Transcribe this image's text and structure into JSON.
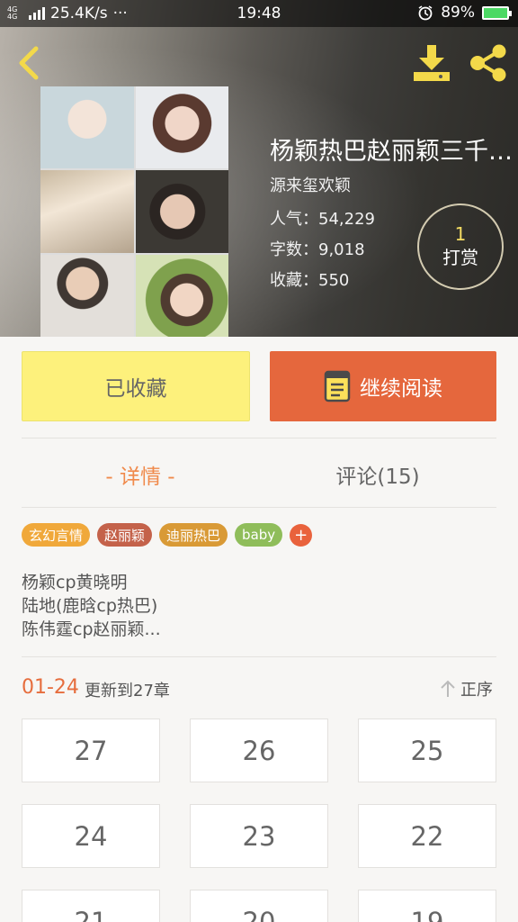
{
  "status_bar": {
    "network_type": "4G 4G",
    "speed": "25.4K/s",
    "dots": "···",
    "time": "19:48",
    "battery": "89%"
  },
  "book": {
    "title": "杨颖热巴赵丽颖三千…",
    "author": "源来玺欢颖",
    "popularity_label": "人气：",
    "popularity": "54,229",
    "words_label": "字数：",
    "words": "9,018",
    "favorites_label": "收藏：",
    "favorites": "550"
  },
  "reward": {
    "count": "1",
    "label": "打赏"
  },
  "actions": {
    "favorited_label": "已收藏",
    "continue_label": "继续阅读"
  },
  "tabs": {
    "detail": "- 详情 -",
    "comments": "评论(15)"
  },
  "tags": [
    {
      "label": "玄幻言情",
      "color": "#f0a83a"
    },
    {
      "label": "赵丽颖",
      "color": "#c4624a"
    },
    {
      "label": "迪丽热巴",
      "color": "#d99a36"
    },
    {
      "label": "baby",
      "color": "#8fbd5a"
    }
  ],
  "tag_add": "+",
  "description": [
    "杨颖cp黄晓明",
    "陆地(鹿晗cp热巴)",
    "陈伟霆cp赵丽颖..."
  ],
  "updates": {
    "range": "01-24",
    "text": "更新到27章",
    "sort_label": "正序"
  },
  "chapters": [
    "27",
    "26",
    "25",
    "24",
    "23",
    "22",
    "21",
    "20",
    "19"
  ],
  "colors": {
    "accent": "#e5673d",
    "favorite_button": "#fdf17c",
    "reward_count": "#f5dd63"
  },
  "icons": {
    "back": "chevron-left-icon",
    "download": "download-icon",
    "share": "share-icon",
    "book": "book-icon",
    "sort": "arrow-up-icon",
    "alarm": "alarm-icon",
    "battery": "battery-icon",
    "signal": "signal-icon"
  }
}
